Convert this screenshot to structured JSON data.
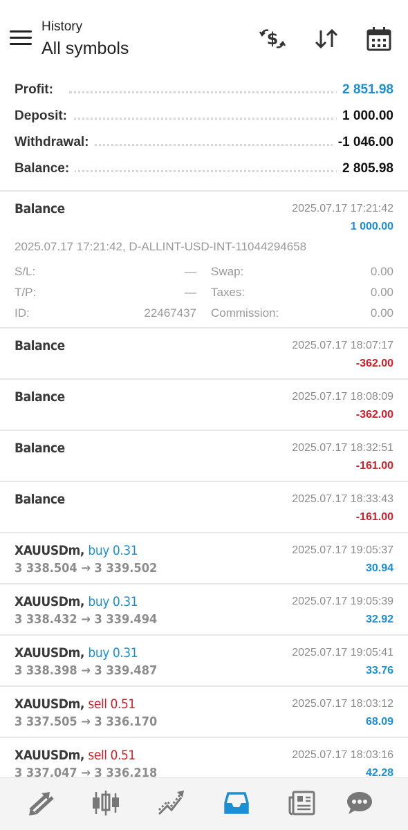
{
  "header": {
    "title_small": "History",
    "title_big": "All symbols",
    "icons": [
      "currency-exchange-icon",
      "sort-icon",
      "calendar-icon"
    ]
  },
  "summary": [
    {
      "label": "Profit:",
      "value": "2 851.98",
      "color": "#1a8fd6"
    },
    {
      "label": "Deposit:",
      "value": "1 000.00",
      "color": "#111111"
    },
    {
      "label": "Withdrawal:",
      "value": "-1 046.00",
      "color": "#111111"
    },
    {
      "label": "Balance:",
      "value": "2 805.98",
      "color": "#111111"
    }
  ],
  "expanded": {
    "title": "Balance",
    "time": "2025.07.17 17:21:42",
    "amount": "1 000.00",
    "comment": "2025.07.17 17:21:42, D-ALLINT-USD-INT-11044294658",
    "sl_label": "S/L:",
    "sl_value": "—",
    "tp_label": "T/P:",
    "tp_value": "—",
    "id_label": "ID:",
    "id_value": "22467437",
    "swap_label": "Swap:",
    "swap_value": "0.00",
    "taxes_label": "Taxes:",
    "taxes_value": "0.00",
    "commission_label": "Commission:",
    "commission_value": "0.00"
  },
  "balances": [
    {
      "title": "Balance",
      "time": "2025.07.17 18:07:17",
      "amount": "-362.00"
    },
    {
      "title": "Balance",
      "time": "2025.07.17 18:08:09",
      "amount": "-362.00"
    },
    {
      "title": "Balance",
      "time": "2025.07.17 18:32:51",
      "amount": "-161.00"
    },
    {
      "title": "Balance",
      "time": "2025.07.17 18:33:43",
      "amount": "-161.00"
    }
  ],
  "trades": [
    {
      "symbol": "XAUUSDm,",
      "action": "buy 0.31",
      "side": "buy",
      "prices": "3 338.504 → 3 339.502",
      "time": "2025.07.17 19:05:37",
      "profit": "30.94"
    },
    {
      "symbol": "XAUUSDm,",
      "action": "buy 0.31",
      "side": "buy",
      "prices": "3 338.432 → 3 339.494",
      "time": "2025.07.17 19:05:39",
      "profit": "32.92"
    },
    {
      "symbol": "XAUUSDm,",
      "action": "buy 0.31",
      "side": "buy",
      "prices": "3 338.398 → 3 339.487",
      "time": "2025.07.17 19:05:41",
      "profit": "33.76"
    },
    {
      "symbol": "XAUUSDm,",
      "action": "sell 0.51",
      "side": "sell",
      "prices": "3 337.505 → 3 336.170",
      "time": "2025.07.17 18:03:12",
      "profit": "68.09"
    },
    {
      "symbol": "XAUUSDm,",
      "action": "sell 0.51",
      "side": "sell",
      "prices": "3 337.047 → 3 336.218",
      "time": "2025.07.17 18:03:16",
      "profit": "42.28"
    }
  ],
  "nav": {
    "items": [
      "quotes-icon",
      "chart-icon",
      "trade-icon",
      "history-icon",
      "news-icon",
      "messages-icon"
    ],
    "active": "history-icon",
    "active_color": "#1a8fd6",
    "inactive_color": "#777777"
  }
}
